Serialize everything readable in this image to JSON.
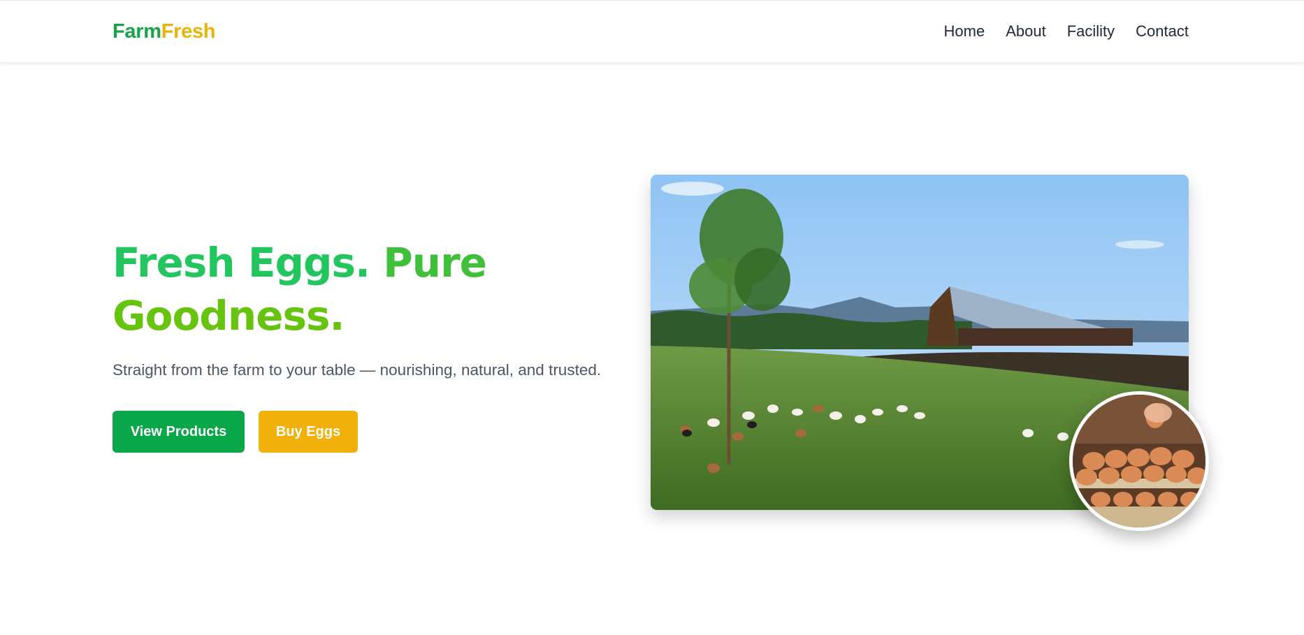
{
  "brand": {
    "part1": "Farm",
    "part2": "Fresh"
  },
  "nav": {
    "items": [
      "Home",
      "About",
      "Facility",
      "Contact"
    ]
  },
  "hero": {
    "title_word1": "Fresh Eggs.",
    "title_word2": "Pure",
    "title_line2": "Goodness.",
    "subtitle": "Straight from the farm to your table — nourishing, natural, and trusted.",
    "btn_primary": "View Products",
    "btn_secondary": "Buy Eggs"
  },
  "images": {
    "main": "farm-barn-poultry-photo",
    "badge": "egg-trays-photo"
  },
  "colors": {
    "brand_green": "#16a34a",
    "brand_yellow": "#eab308",
    "button_green": "#0aa64a",
    "button_yellow": "#f0b10b",
    "title_green": "#22c55e",
    "title_lime": "#66c40f"
  }
}
